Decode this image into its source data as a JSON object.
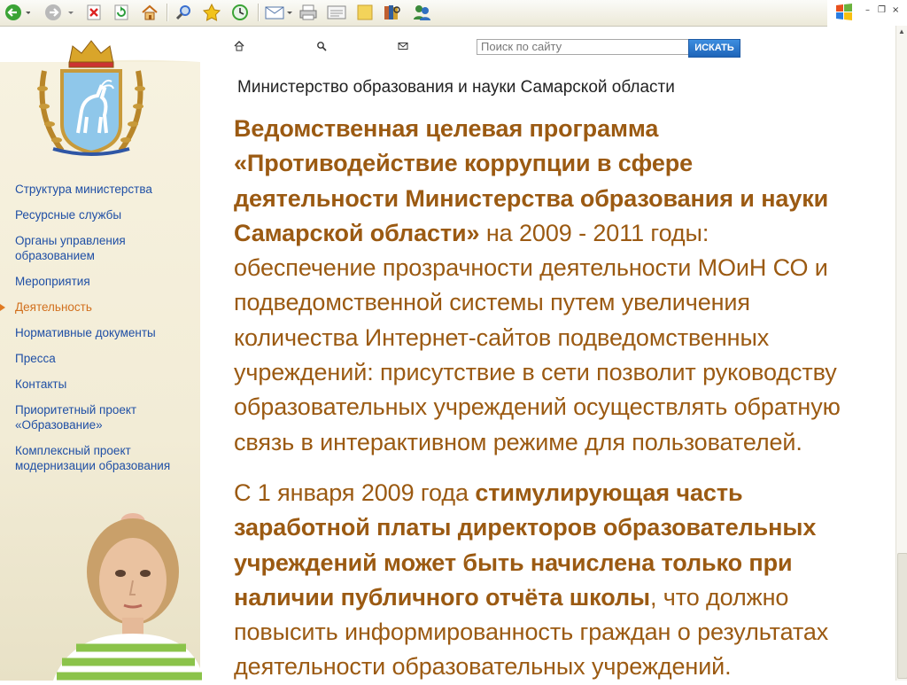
{
  "toolbar": {
    "buttons": [
      {
        "name": "back-icon",
        "color": "#3aa335"
      },
      {
        "name": "forward-icon",
        "color": "#9a9a9a"
      },
      {
        "name": "stop-icon",
        "color": "#d22"
      },
      {
        "name": "refresh-icon",
        "color": "#2a9d3a"
      },
      {
        "name": "home-icon",
        "color": "#e08a2a"
      },
      {
        "name": "search-icon",
        "color": "#3a6fd0"
      },
      {
        "name": "favorites-icon",
        "color": "#f2c31b"
      },
      {
        "name": "history-icon",
        "color": "#3aa335"
      },
      {
        "name": "mail-icon",
        "color": "#5577aa"
      },
      {
        "name": "print-icon",
        "color": "#888"
      },
      {
        "name": "edit-icon",
        "color": "#666"
      },
      {
        "name": "discuss-icon",
        "color": "#f3d35a"
      },
      {
        "name": "research-icon",
        "color": "#8a6a2a"
      },
      {
        "name": "messenger-icon",
        "color": "#3b8a3b"
      }
    ]
  },
  "window": {
    "minimize": "–",
    "restore": "❐",
    "close": "×"
  },
  "header": {
    "search_placeholder": "Поиск по сайту",
    "search_button": "ИСКАТЬ",
    "ministry_title": "Министерство образования и науки Самарской области"
  },
  "sidebar": {
    "items": [
      {
        "label": "Структура министерства"
      },
      {
        "label": "Ресурсные службы"
      },
      {
        "label": "Органы управления образованием"
      },
      {
        "label": "Мероприятия"
      },
      {
        "label": "Деятельность",
        "active": true
      },
      {
        "label": "Нормативные документы"
      },
      {
        "label": "Пресса"
      },
      {
        "label": "Контакты"
      },
      {
        "label": "Приоритетный проект «Образование»"
      },
      {
        "label": "Комплексный проект модернизации образования"
      }
    ]
  },
  "content": {
    "p1_bold": "Ведомственная целевая программа «Противодействие коррупции в сфере деятельности Министерства образования и науки Самарской области»",
    "p1_rest": " на 2009 - 2011 годы: обеспечение прозрачности деятельности МОиН СО и подведомственной системы путем увеличения количества Интернет-сайтов подведомственных учреждений:  присутствие в сети позволит руководству образовательных учреждений осуществлять обратную связь в интерактивном режиме для пользователей.",
    "p2_start": "С 1 января 2009 года ",
    "p2_bold": "стимулирующая часть заработной платы директоров образовательных учреждений может быть начислена только при наличии публичного отчёта школы",
    "p2_rest": ", что должно повысить информированность граждан о результатах деятельности образовательных учреждений."
  },
  "colors": {
    "text": "#9b5a12",
    "nav": "#1f4fa5",
    "nav_active": "#d2701e"
  }
}
